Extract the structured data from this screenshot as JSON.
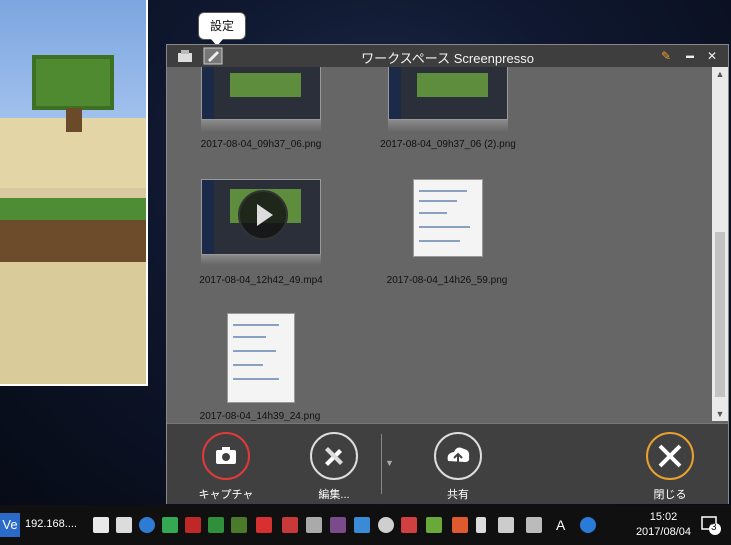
{
  "tooltip": "設定",
  "window": {
    "title": "ワークスペース Screenpresso",
    "pin": "✎",
    "minimize": "▬",
    "close": "✕"
  },
  "files": [
    {
      "name": "2017-08-04_09h37_06.png",
      "kind": "screenshot"
    },
    {
      "name": "2017-08-04_09h37_06 (2).png",
      "kind": "screenshot"
    },
    {
      "name": "2017-08-04_12h42_49.mp4",
      "kind": "video"
    },
    {
      "name": "2017-08-04_14h26_59.png",
      "kind": "document"
    },
    {
      "name": "2017-08-04_14h39_24.png",
      "kind": "document"
    }
  ],
  "toolbar": {
    "capture": "キャプチャ",
    "edit": "編集...",
    "share": "共有",
    "close": "閉じる"
  },
  "taskbar": {
    "app_label": "Ve",
    "ip": "192.168....",
    "time": "15:02",
    "date": "2017/08/04",
    "notification_count": "3"
  },
  "colors": {
    "capture_ring": "#e03a3a",
    "close_ring": "#e8a030",
    "toolbar_bg": "#404040",
    "workspace_bg": "#666666"
  }
}
